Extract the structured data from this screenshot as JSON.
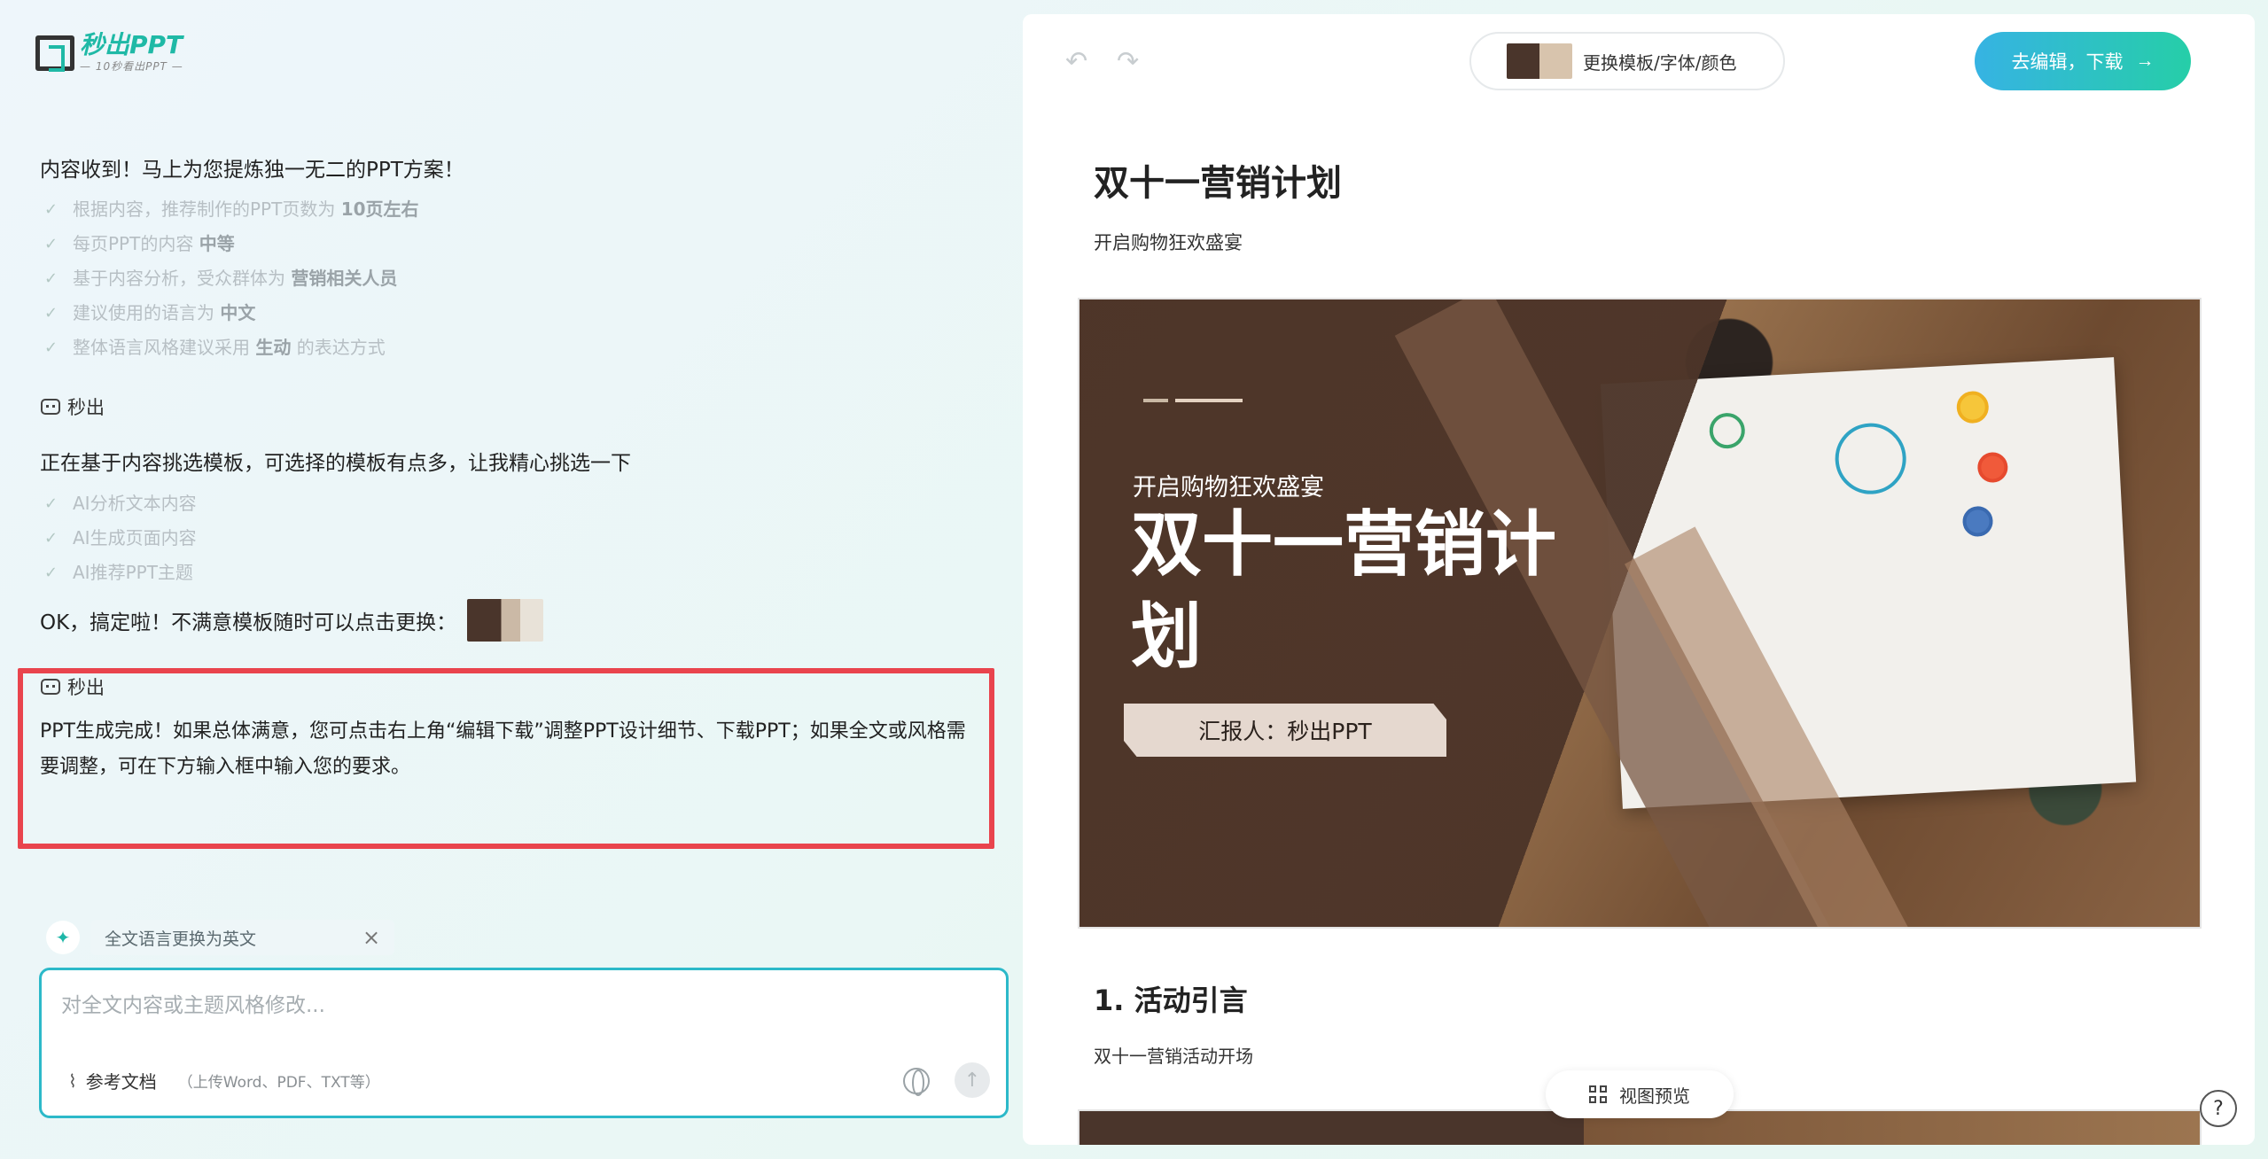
{
  "logo": {
    "title": "秒出PPT",
    "subtitle": "— 10秒看出PPT —"
  },
  "chat": {
    "msg1": "内容收到！马上为您提炼独一无二的PPT方案！",
    "checks1": [
      {
        "text": "根据内容，推荐制作的PPT页数为 ",
        "bold": "10页左右"
      },
      {
        "text": "每页PPT的内容 ",
        "bold": "中等"
      },
      {
        "text": "基于内容分析，受众群体为 ",
        "bold": "营销相关人员"
      },
      {
        "text": "建议使用的语言为 ",
        "bold": "中文"
      },
      {
        "text": "整体语言风格建议采用 ",
        "bold": "生动",
        "tail": " 的表达方式"
      }
    ],
    "bot_name": "秒出",
    "msg2": "正在基于内容挑选模板，可选择的模板有点多，让我精心挑选一下",
    "checks2": [
      "AI分析文本内容",
      "AI生成页面内容",
      "AI推荐PPT主题"
    ],
    "msg3": "OK，搞定啦！不满意模板随时可以点击更换：",
    "final_msg": "PPT生成完成！如果总体满意，您可点击右上角“编辑下载”调整PPT设计细节、下载PPT；如果全文或风格需要调整，可在下方输入框中输入您的要求。"
  },
  "suggestion_chip": {
    "label": "全文语言更换为英文",
    "close": "×"
  },
  "input": {
    "placeholder": "对全文内容或主题风格修改...",
    "attach_label": "参考文档",
    "attach_hint": "（上传Word、PDF、TXT等）",
    "send": "↑"
  },
  "toolbar": {
    "undo": "↶",
    "redo": "↷",
    "template_btn": "更换模板/字体/颜色",
    "edit_btn": "去编辑，下载",
    "edit_arrow": "→"
  },
  "document": {
    "title": "双十一营销计划",
    "subtitle": "开启购物狂欢盛宴",
    "slide": {
      "subtitle": "开启购物狂欢盛宴",
      "title": "双十一营销计划",
      "reporter": "汇报人：秒出PPT"
    },
    "section1_title": "1. 活动引言",
    "section1_sub": "双十一营销活动开场"
  },
  "view_btn": "视图预览",
  "help": "?"
}
